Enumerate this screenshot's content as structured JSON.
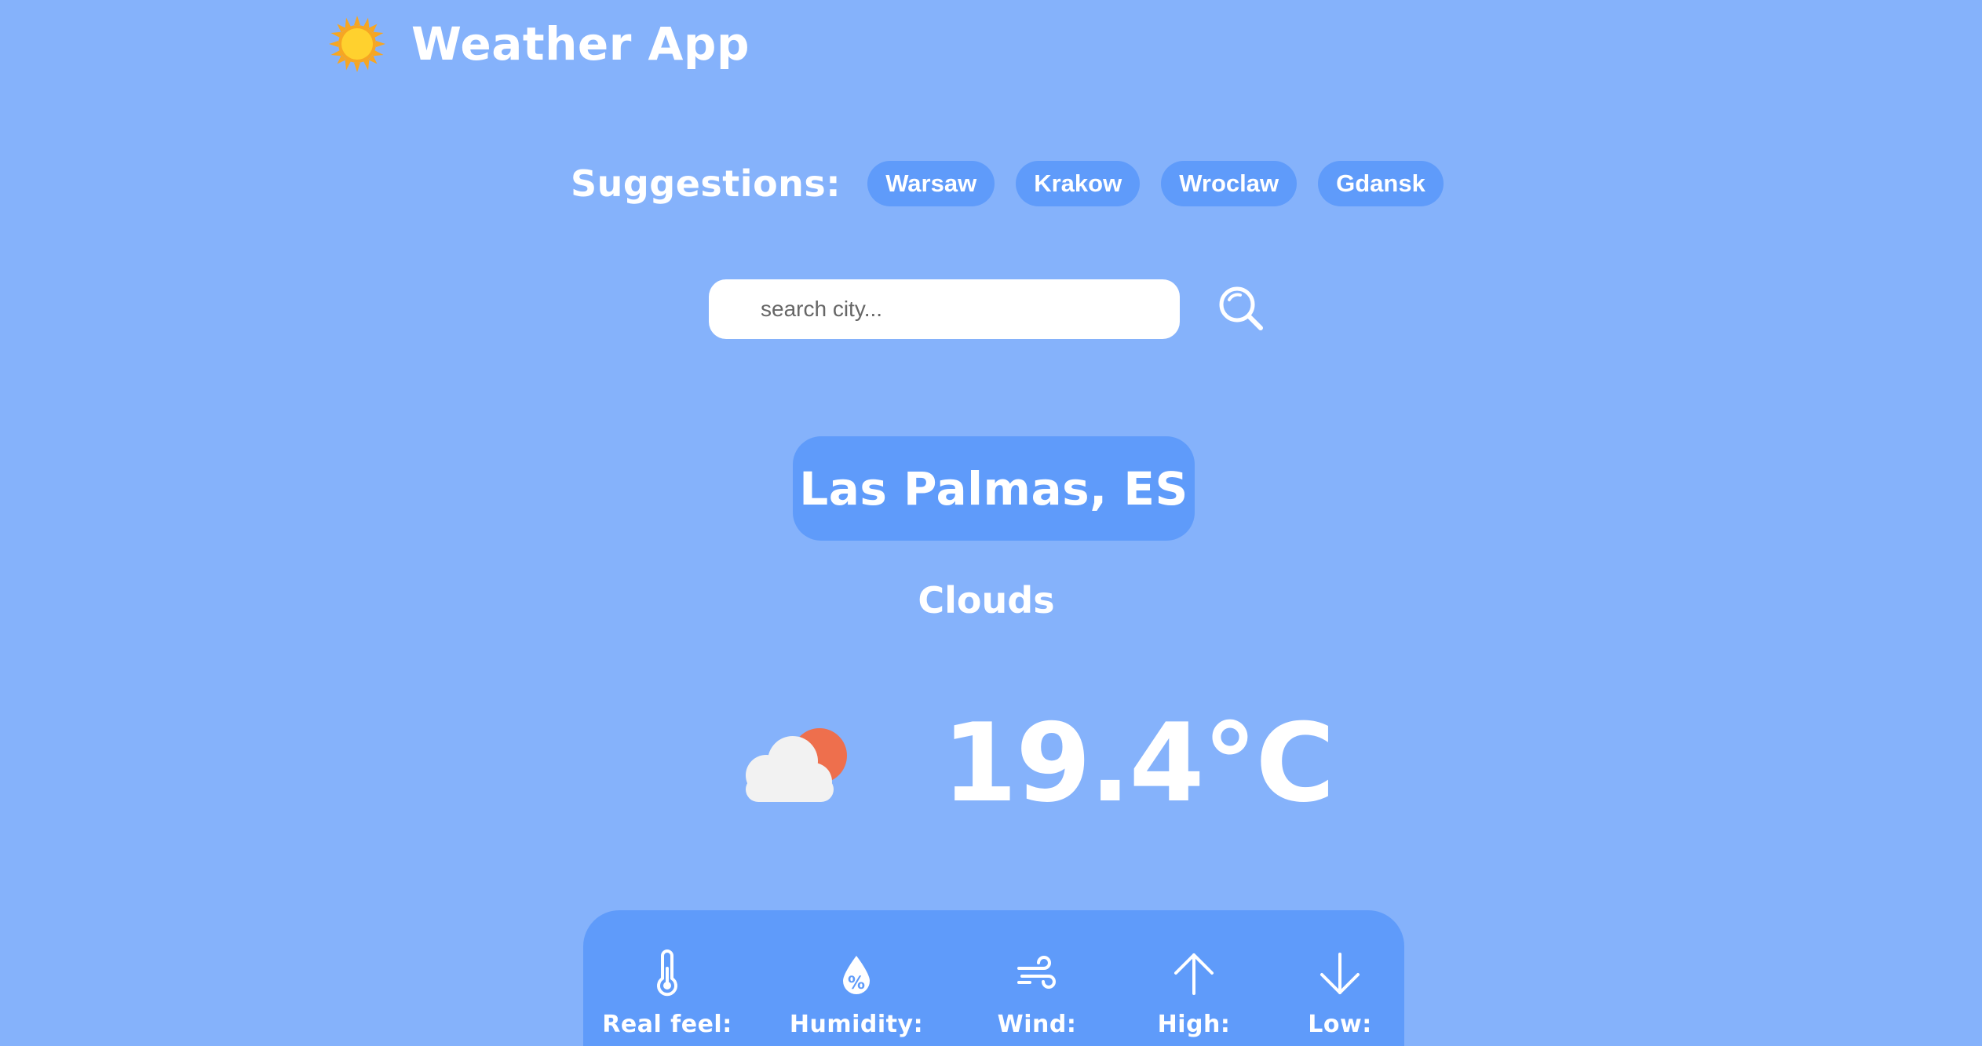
{
  "header": {
    "title": "Weather App",
    "logo_icon": "sun-icon"
  },
  "suggestions": {
    "label": "Suggestions:",
    "cities": [
      "Warsaw",
      "Krakow",
      "Wroclaw",
      "Gdansk"
    ]
  },
  "search": {
    "placeholder": "search city...",
    "value": "",
    "button_icon": "search-icon"
  },
  "current": {
    "city": "Las Palmas, ES",
    "condition": "Clouds",
    "condition_icon": "cloud-sun-icon",
    "temperature": "19.4°C"
  },
  "details": [
    {
      "label": "Real feel:",
      "icon": "thermometer-icon"
    },
    {
      "label": "Humidity:",
      "icon": "humidity-drop-icon"
    },
    {
      "label": "Wind:",
      "icon": "wind-icon"
    },
    {
      "label": "High:",
      "icon": "arrow-up-icon"
    },
    {
      "label": "Low:",
      "icon": "arrow-down-icon"
    }
  ],
  "colors": {
    "background": "#85b2fb",
    "accent": "#5f9bfa",
    "text": "#ffffff",
    "sun": "#ffd12e",
    "sun_rays": "#f6a623",
    "sun_behind_cloud": "#ee6f4d",
    "cloud": "#f2f2f2"
  }
}
